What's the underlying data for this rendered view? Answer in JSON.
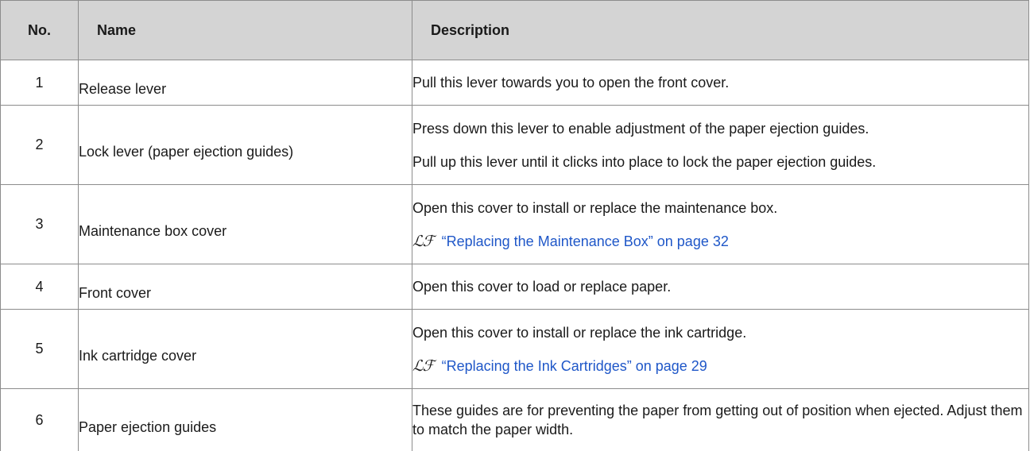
{
  "table": {
    "headers": {
      "no": "No.",
      "name": "Name",
      "description": "Description"
    },
    "rows": [
      {
        "no": "1",
        "name": "Release lever",
        "desc": [
          "Pull this lever towards you to open the front cover."
        ]
      },
      {
        "no": "2",
        "name": "Lock lever (paper ejection guides)",
        "desc": [
          "Press down this lever to enable adjustment of the paper ejection guides.",
          "Pull up this lever until it clicks into place to lock the paper ejection guides."
        ]
      },
      {
        "no": "3",
        "name": "Maintenance box cover",
        "desc": [
          "Open this cover to install or replace the maintenance box."
        ],
        "link": "“Replacing the Maintenance Box” on page 32"
      },
      {
        "no": "4",
        "name": "Front cover",
        "desc": [
          "Open this cover to load or replace paper."
        ]
      },
      {
        "no": "5",
        "name": "Ink cartridge cover",
        "desc": [
          "Open this cover to install or replace the ink cartridge."
        ],
        "link": "“Replacing the Ink Cartridges” on page 29"
      },
      {
        "no": "6",
        "name": "Paper ejection guides",
        "desc": [
          "These guides are for preventing the paper from getting out of position when ejected. Adjust them to match the paper width."
        ]
      }
    ]
  },
  "reference_icon": "pointing-hand-reference-icon",
  "colors": {
    "header_bg": "#d4d4d4",
    "link": "#1f57c8",
    "border": "#8c8c8c"
  }
}
